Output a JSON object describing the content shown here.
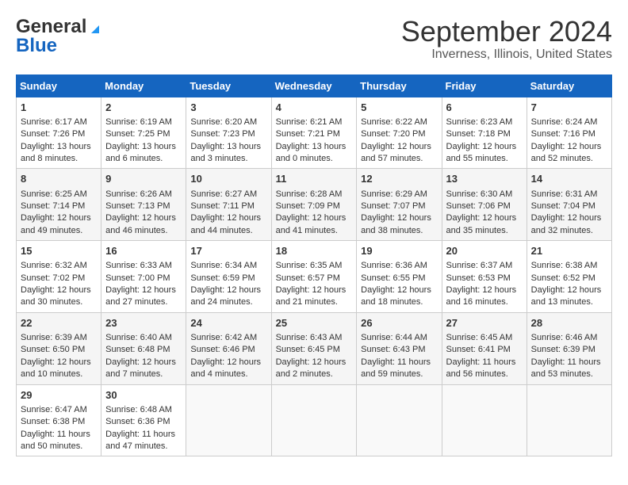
{
  "header": {
    "logo_general": "General",
    "logo_blue": "Blue",
    "month": "September 2024",
    "location": "Inverness, Illinois, United States"
  },
  "weekdays": [
    "Sunday",
    "Monday",
    "Tuesday",
    "Wednesday",
    "Thursday",
    "Friday",
    "Saturday"
  ],
  "weeks": [
    [
      {
        "day": "1",
        "sunrise": "Sunrise: 6:17 AM",
        "sunset": "Sunset: 7:26 PM",
        "daylight": "Daylight: 13 hours and 8 minutes."
      },
      {
        "day": "2",
        "sunrise": "Sunrise: 6:19 AM",
        "sunset": "Sunset: 7:25 PM",
        "daylight": "Daylight: 13 hours and 6 minutes."
      },
      {
        "day": "3",
        "sunrise": "Sunrise: 6:20 AM",
        "sunset": "Sunset: 7:23 PM",
        "daylight": "Daylight: 13 hours and 3 minutes."
      },
      {
        "day": "4",
        "sunrise": "Sunrise: 6:21 AM",
        "sunset": "Sunset: 7:21 PM",
        "daylight": "Daylight: 13 hours and 0 minutes."
      },
      {
        "day": "5",
        "sunrise": "Sunrise: 6:22 AM",
        "sunset": "Sunset: 7:20 PM",
        "daylight": "Daylight: 12 hours and 57 minutes."
      },
      {
        "day": "6",
        "sunrise": "Sunrise: 6:23 AM",
        "sunset": "Sunset: 7:18 PM",
        "daylight": "Daylight: 12 hours and 55 minutes."
      },
      {
        "day": "7",
        "sunrise": "Sunrise: 6:24 AM",
        "sunset": "Sunset: 7:16 PM",
        "daylight": "Daylight: 12 hours and 52 minutes."
      }
    ],
    [
      {
        "day": "8",
        "sunrise": "Sunrise: 6:25 AM",
        "sunset": "Sunset: 7:14 PM",
        "daylight": "Daylight: 12 hours and 49 minutes."
      },
      {
        "day": "9",
        "sunrise": "Sunrise: 6:26 AM",
        "sunset": "Sunset: 7:13 PM",
        "daylight": "Daylight: 12 hours and 46 minutes."
      },
      {
        "day": "10",
        "sunrise": "Sunrise: 6:27 AM",
        "sunset": "Sunset: 7:11 PM",
        "daylight": "Daylight: 12 hours and 44 minutes."
      },
      {
        "day": "11",
        "sunrise": "Sunrise: 6:28 AM",
        "sunset": "Sunset: 7:09 PM",
        "daylight": "Daylight: 12 hours and 41 minutes."
      },
      {
        "day": "12",
        "sunrise": "Sunrise: 6:29 AM",
        "sunset": "Sunset: 7:07 PM",
        "daylight": "Daylight: 12 hours and 38 minutes."
      },
      {
        "day": "13",
        "sunrise": "Sunrise: 6:30 AM",
        "sunset": "Sunset: 7:06 PM",
        "daylight": "Daylight: 12 hours and 35 minutes."
      },
      {
        "day": "14",
        "sunrise": "Sunrise: 6:31 AM",
        "sunset": "Sunset: 7:04 PM",
        "daylight": "Daylight: 12 hours and 32 minutes."
      }
    ],
    [
      {
        "day": "15",
        "sunrise": "Sunrise: 6:32 AM",
        "sunset": "Sunset: 7:02 PM",
        "daylight": "Daylight: 12 hours and 30 minutes."
      },
      {
        "day": "16",
        "sunrise": "Sunrise: 6:33 AM",
        "sunset": "Sunset: 7:00 PM",
        "daylight": "Daylight: 12 hours and 27 minutes."
      },
      {
        "day": "17",
        "sunrise": "Sunrise: 6:34 AM",
        "sunset": "Sunset: 6:59 PM",
        "daylight": "Daylight: 12 hours and 24 minutes."
      },
      {
        "day": "18",
        "sunrise": "Sunrise: 6:35 AM",
        "sunset": "Sunset: 6:57 PM",
        "daylight": "Daylight: 12 hours and 21 minutes."
      },
      {
        "day": "19",
        "sunrise": "Sunrise: 6:36 AM",
        "sunset": "Sunset: 6:55 PM",
        "daylight": "Daylight: 12 hours and 18 minutes."
      },
      {
        "day": "20",
        "sunrise": "Sunrise: 6:37 AM",
        "sunset": "Sunset: 6:53 PM",
        "daylight": "Daylight: 12 hours and 16 minutes."
      },
      {
        "day": "21",
        "sunrise": "Sunrise: 6:38 AM",
        "sunset": "Sunset: 6:52 PM",
        "daylight": "Daylight: 12 hours and 13 minutes."
      }
    ],
    [
      {
        "day": "22",
        "sunrise": "Sunrise: 6:39 AM",
        "sunset": "Sunset: 6:50 PM",
        "daylight": "Daylight: 12 hours and 10 minutes."
      },
      {
        "day": "23",
        "sunrise": "Sunrise: 6:40 AM",
        "sunset": "Sunset: 6:48 PM",
        "daylight": "Daylight: 12 hours and 7 minutes."
      },
      {
        "day": "24",
        "sunrise": "Sunrise: 6:42 AM",
        "sunset": "Sunset: 6:46 PM",
        "daylight": "Daylight: 12 hours and 4 minutes."
      },
      {
        "day": "25",
        "sunrise": "Sunrise: 6:43 AM",
        "sunset": "Sunset: 6:45 PM",
        "daylight": "Daylight: 12 hours and 2 minutes."
      },
      {
        "day": "26",
        "sunrise": "Sunrise: 6:44 AM",
        "sunset": "Sunset: 6:43 PM",
        "daylight": "Daylight: 11 hours and 59 minutes."
      },
      {
        "day": "27",
        "sunrise": "Sunrise: 6:45 AM",
        "sunset": "Sunset: 6:41 PM",
        "daylight": "Daylight: 11 hours and 56 minutes."
      },
      {
        "day": "28",
        "sunrise": "Sunrise: 6:46 AM",
        "sunset": "Sunset: 6:39 PM",
        "daylight": "Daylight: 11 hours and 53 minutes."
      }
    ],
    [
      {
        "day": "29",
        "sunrise": "Sunrise: 6:47 AM",
        "sunset": "Sunset: 6:38 PM",
        "daylight": "Daylight: 11 hours and 50 minutes."
      },
      {
        "day": "30",
        "sunrise": "Sunrise: 6:48 AM",
        "sunset": "Sunset: 6:36 PM",
        "daylight": "Daylight: 11 hours and 47 minutes."
      },
      {
        "day": "",
        "sunrise": "",
        "sunset": "",
        "daylight": ""
      },
      {
        "day": "",
        "sunrise": "",
        "sunset": "",
        "daylight": ""
      },
      {
        "day": "",
        "sunrise": "",
        "sunset": "",
        "daylight": ""
      },
      {
        "day": "",
        "sunrise": "",
        "sunset": "",
        "daylight": ""
      },
      {
        "day": "",
        "sunrise": "",
        "sunset": "",
        "daylight": ""
      }
    ]
  ]
}
